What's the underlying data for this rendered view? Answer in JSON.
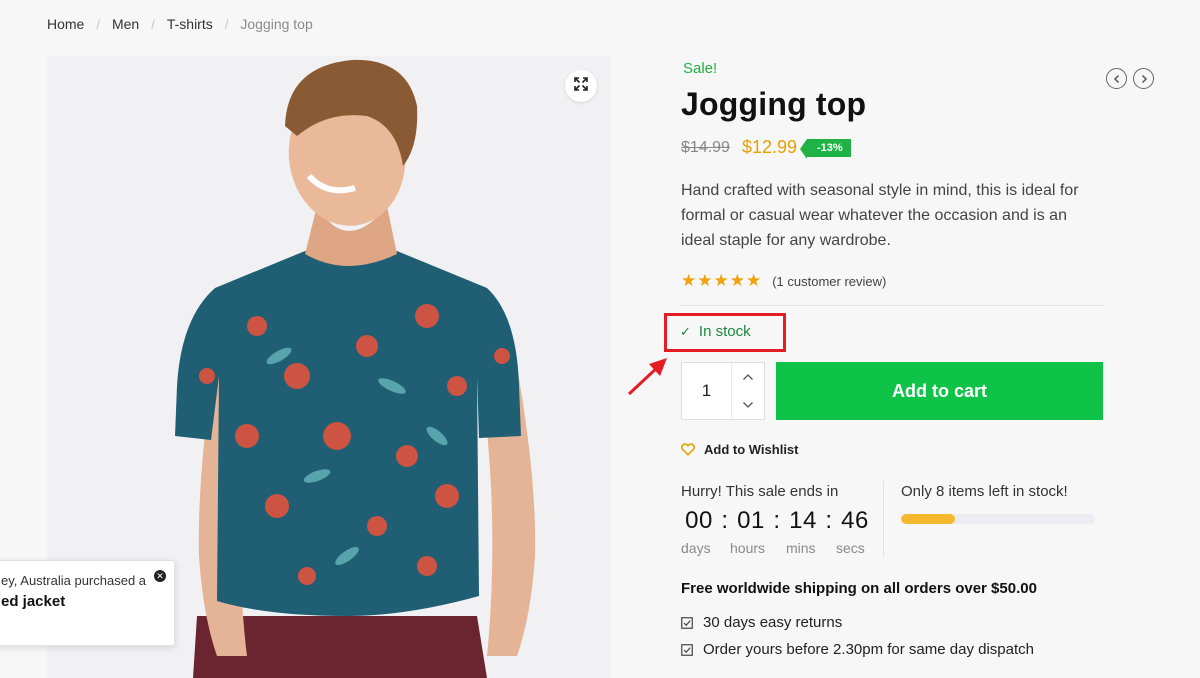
{
  "breadcrumb": {
    "items": [
      "Home",
      "Men",
      "T-shirts"
    ],
    "current": "Jogging top"
  },
  "product": {
    "sale_label": "Sale!",
    "title": "Jogging top",
    "old_price": "$14.99",
    "new_price": "$12.99",
    "discount": "-13%",
    "description": "Hand crafted with seasonal style in mind, this is ideal for formal or casual wear whatever the occasion and is an ideal staple for any wardrobe.",
    "stars": "★★★★★",
    "review_text": "(1 customer review)",
    "stock_status": "In stock"
  },
  "cart": {
    "quantity": "1",
    "add_label": "Add to cart"
  },
  "wishlist": {
    "label": "Add to Wishlist"
  },
  "countdown": {
    "title": "Hurry! This sale ends in",
    "days": "00",
    "hours": "01",
    "mins": "14",
    "secs": "46",
    "labels": {
      "days": "days",
      "hours": "hours",
      "mins": "mins",
      "secs": "secs"
    }
  },
  "scarcity": {
    "text": "Only 8 items left in stock!",
    "fill_fraction": 0.28
  },
  "shipping": {
    "headline": "Free worldwide shipping on all orders over $50.00",
    "perks": [
      "30 days easy returns",
      "Order yours before 2.30pm for same day dispatch"
    ]
  },
  "toast": {
    "line1": "ey, Australia purchased a",
    "line2": "ed jacket"
  },
  "colors": {
    "accent_green": "#0fc348",
    "sale_green": "#20b33f",
    "price_orange": "#e6a100",
    "annotation_red": "#e41c23",
    "star": "#f0a20a"
  },
  "icons": {
    "expand": "expand-icon",
    "prev": "chevron-left-icon",
    "next": "chevron-right-icon",
    "heart": "heart-icon",
    "check": "check-icon"
  }
}
